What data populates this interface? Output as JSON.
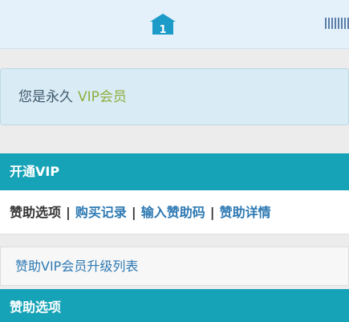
{
  "header": {
    "home_icon": "home-icon",
    "menu_icon": "menu-icon"
  },
  "alert": {
    "prefix": "您是永久",
    "vip_label": "VIP会员"
  },
  "open_vip": {
    "title": "开通VIP"
  },
  "nav": {
    "current": "赞助选项",
    "separator": "|",
    "links": [
      "购买记录",
      "输入赞助码",
      "赞助详情"
    ]
  },
  "upgrade_list": {
    "label": "赞助VIP会员升级列表"
  },
  "sponsor_options": {
    "title": "赞助选项"
  },
  "colors": {
    "accent": "#17a3b7",
    "link": "#2d79b3",
    "vip_green": "#8fae3e"
  }
}
